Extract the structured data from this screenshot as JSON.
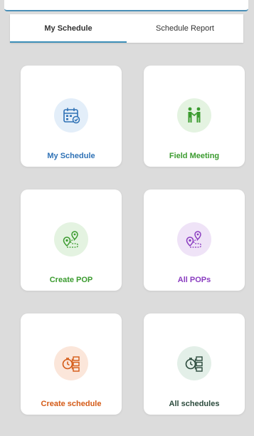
{
  "tabs": [
    {
      "label": "My Schedule",
      "active": true
    },
    {
      "label": "Schedule Report",
      "active": false
    }
  ],
  "cards": [
    {
      "label": "My Schedule",
      "icon": "calendar-check-icon",
      "color": "#2f72b6",
      "bg": "#e3eef9"
    },
    {
      "label": "Field Meeting",
      "icon": "handshake-people-icon",
      "color": "#3b9b2f",
      "bg": "#e4f3e1"
    },
    {
      "label": "Create POP",
      "icon": "route-pins-icon",
      "color": "#3b9b2f",
      "bg": "#e4f3e1"
    },
    {
      "label": "All POPs",
      "icon": "route-pins-icon",
      "color": "#8a3cc0",
      "bg": "#efe3f7"
    },
    {
      "label": "Create schedule",
      "icon": "clock-list-icon",
      "color": "#d45a16",
      "bg": "#fbe6da"
    },
    {
      "label": "All schedules",
      "icon": "clock-list-icon",
      "color": "#2b4a3c",
      "bg": "#e3efe8"
    }
  ]
}
